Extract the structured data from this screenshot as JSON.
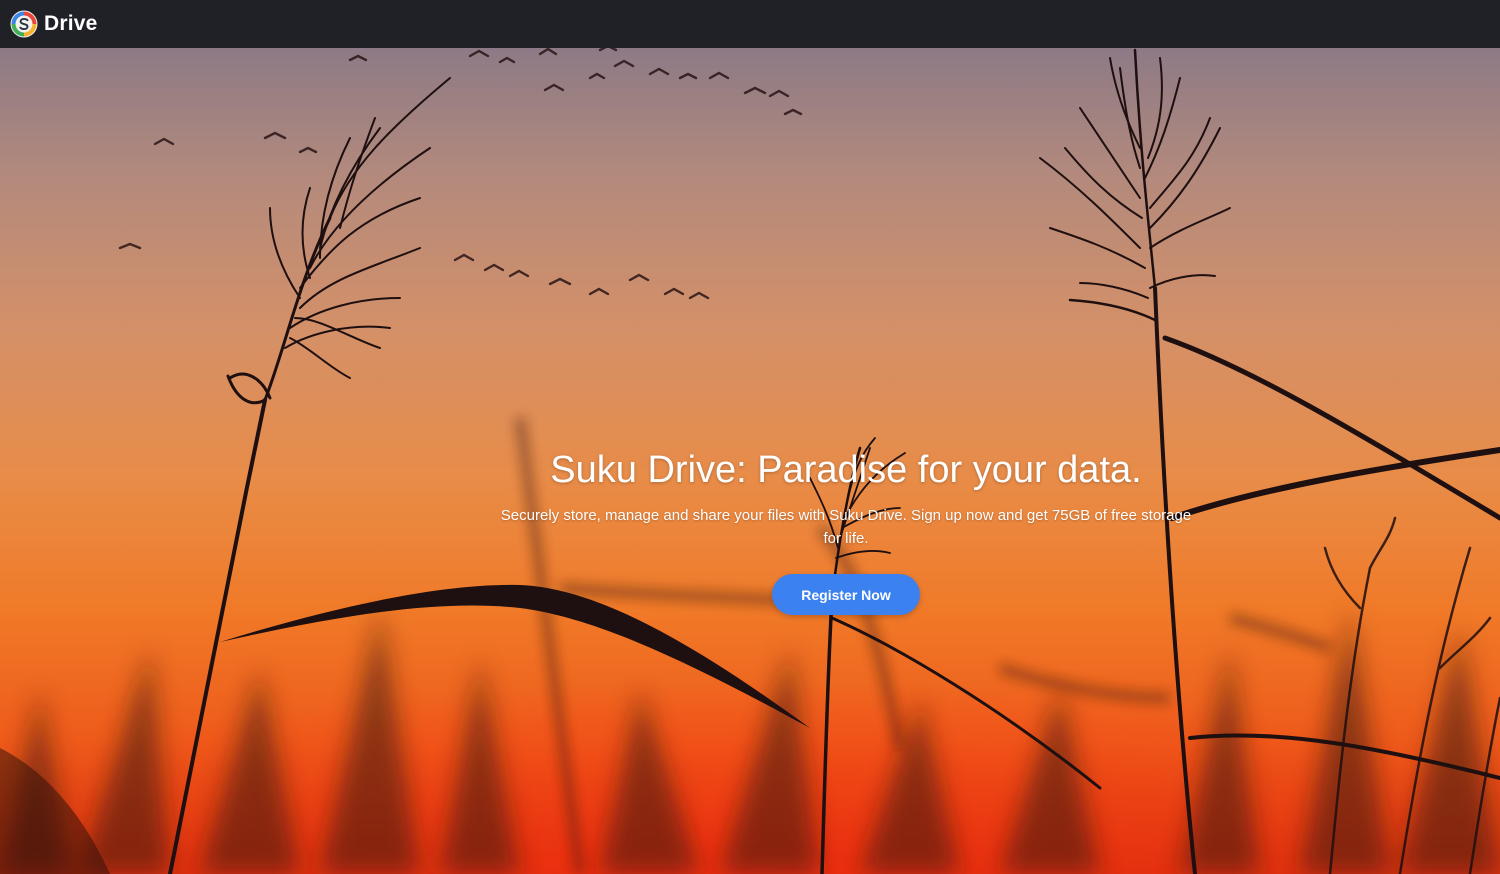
{
  "header": {
    "brand": "Drive",
    "logo_icon": "suku-logo-icon",
    "background": "#202027"
  },
  "hero": {
    "title": "Suku Drive: Paradise for your data.",
    "subtitle": "Securely store, manage and share your files with Suku Drive. Sign up now and get 75GB of free storage for life.",
    "cta_label": "Register Now",
    "cta_color": "#3b82f0",
    "background_description_icon": "sunset-reeds-photo"
  }
}
